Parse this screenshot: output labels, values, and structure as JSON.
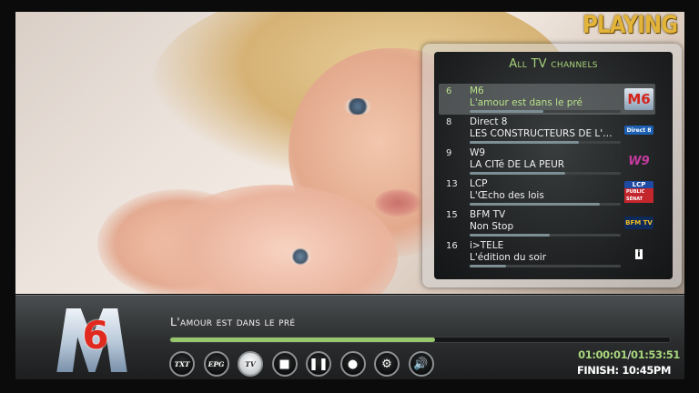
{
  "status": {
    "playing_label": "PLAYING"
  },
  "channel_list": {
    "title": "All TV channels",
    "selected_index": 0,
    "items": [
      {
        "number": "6",
        "name": "M6",
        "program": "L'amour est dans le pré",
        "progress": 0.49,
        "logo_text": "M6"
      },
      {
        "number": "8",
        "name": "Direct 8",
        "program": "LES CONSTRUCTEURS DE L'EXTRÊME",
        "progress": 0.72,
        "logo_text": "Direct 8"
      },
      {
        "number": "9",
        "name": "W9",
        "program": "LA CITé DE LA PEUR",
        "progress": 0.63,
        "logo_text": "W9"
      },
      {
        "number": "13",
        "name": "LCP",
        "program": "L'Œcho des lois",
        "progress": 0.86,
        "logo_text": "LCP"
      },
      {
        "number": "15",
        "name": "BFM TV",
        "program": "Non Stop",
        "progress": 0.53,
        "logo_text": "BFM TV"
      },
      {
        "number": "16",
        "name": "i>TELE",
        "program": "L'édition du soir",
        "progress": 0.24,
        "logo_text": "i>TELE"
      }
    ]
  },
  "player": {
    "channel_logo_text": "6",
    "program_title": "L'amour est dans le pré",
    "progress": 0.53,
    "elapsed": "01:00:01",
    "separator": "/",
    "total": "01:53:51",
    "finish": "FINISH: 10:45PM",
    "controls": [
      {
        "id": "txt",
        "label": "TXT",
        "icon": "teletext-icon"
      },
      {
        "id": "epg",
        "label": "EPG",
        "icon": "epg-icon"
      },
      {
        "id": "tv",
        "label": "TV",
        "icon": "tv-icon",
        "active": true
      },
      {
        "id": "stop",
        "label": "■",
        "icon": "stop-icon"
      },
      {
        "id": "pause",
        "label": "❚❚",
        "icon": "pause-icon"
      },
      {
        "id": "record",
        "label": "●",
        "icon": "record-icon"
      },
      {
        "id": "settings",
        "label": "⚙",
        "icon": "gear-icon"
      },
      {
        "id": "volume",
        "label": "🔊",
        "icon": "volume-icon"
      }
    ]
  },
  "colors": {
    "accent_green": "#97c66d",
    "playing_gold": "#e2b53a",
    "m6_red": "#e12a1f"
  }
}
